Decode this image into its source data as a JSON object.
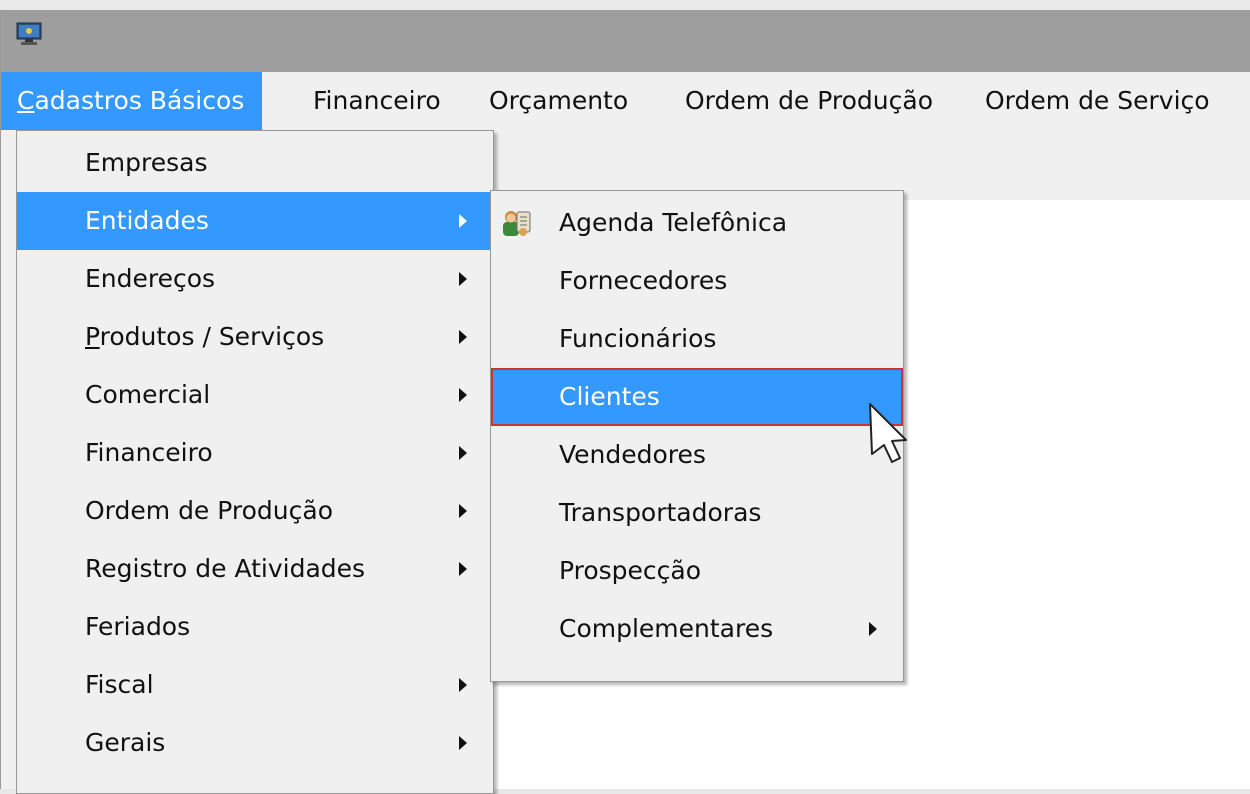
{
  "menubar": {
    "items": [
      {
        "label_underlined": "C",
        "label_rest": "adastros Básicos"
      },
      {
        "label": "Financeiro"
      },
      {
        "label": "Orçamento"
      },
      {
        "label": "Ordem de Produção"
      },
      {
        "label": "Ordem de Serviço"
      }
    ]
  },
  "menu_cadastros": {
    "items": [
      {
        "label": "Empresas"
      },
      {
        "label": "Entidades"
      },
      {
        "label": "Endereços"
      },
      {
        "label_underlined": "P",
        "label_rest": "rodutos / Serviços"
      },
      {
        "label": "Comercial"
      },
      {
        "label": "Financeiro"
      },
      {
        "label": "Ordem de Produção"
      },
      {
        "label": "Registro de Atividades"
      },
      {
        "label": "Feriados"
      },
      {
        "label": "Fiscal"
      },
      {
        "label": "Gerais"
      }
    ]
  },
  "menu_entidades": {
    "items": [
      {
        "label": "Agenda Telefônica",
        "icon": "contacts-icon"
      },
      {
        "label": "Fornecedores"
      },
      {
        "label": "Funcionários"
      },
      {
        "label": "Clientes"
      },
      {
        "label": "Vendedores"
      },
      {
        "label": "Transportadoras"
      },
      {
        "label": "Prospecção"
      },
      {
        "label": "Complementares"
      }
    ]
  },
  "colors": {
    "highlight": "#3399ff",
    "selection_border": "#cc3333",
    "title_bar": "#9e9e9e",
    "menu_background": "#f0f0f0"
  }
}
